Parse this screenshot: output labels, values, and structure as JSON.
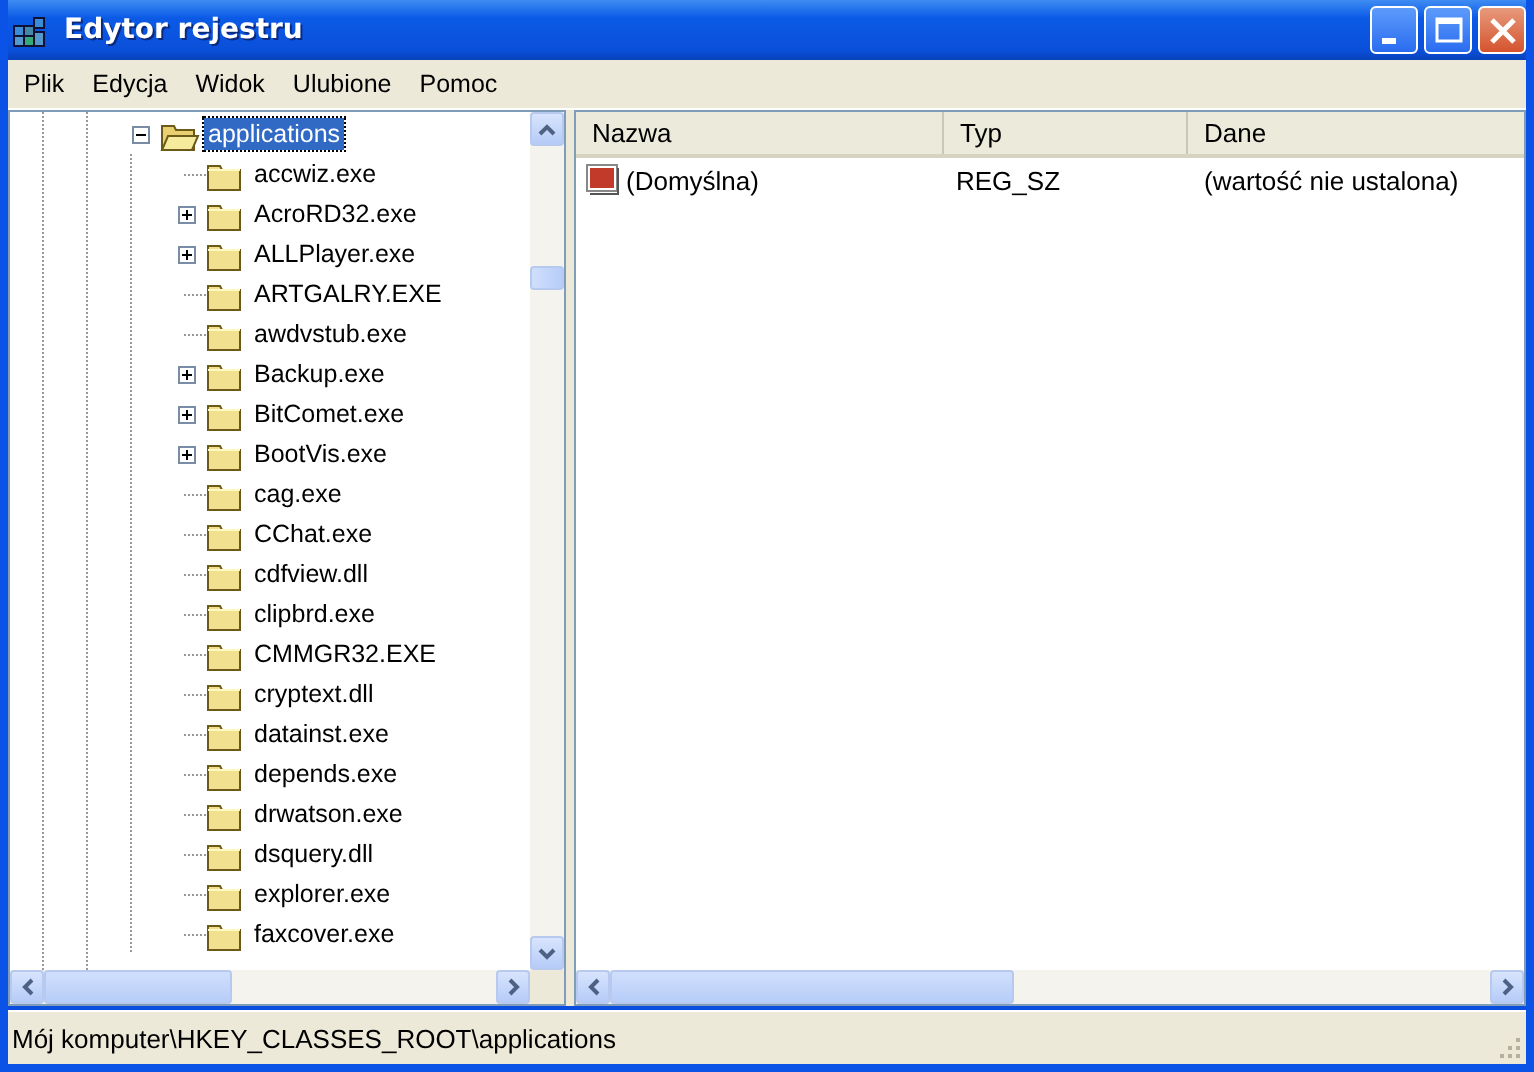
{
  "window": {
    "title": "Edytor rejestru"
  },
  "menu": [
    "Plik",
    "Edycja",
    "Widok",
    "Ulubione",
    "Pomoc"
  ],
  "tree": [
    {
      "label": "applications",
      "expanded": true,
      "selected": true,
      "children": [
        {
          "label": "accwiz.exe",
          "has_children": false,
          "selected": false
        },
        {
          "label": "AcroRD32.exe",
          "has_children": true,
          "selected": false
        },
        {
          "label": "ALLPlayer.exe",
          "has_children": true,
          "selected": false
        },
        {
          "label": "ARTGALRY.EXE",
          "has_children": false,
          "selected": false
        },
        {
          "label": "awdvstub.exe",
          "has_children": false,
          "selected": false
        },
        {
          "label": "Backup.exe",
          "has_children": true,
          "selected": false
        },
        {
          "label": "BitComet.exe",
          "has_children": true,
          "selected": false
        },
        {
          "label": "BootVis.exe",
          "has_children": true,
          "selected": false
        },
        {
          "label": "cag.exe",
          "has_children": false,
          "selected": false
        },
        {
          "label": "CChat.exe",
          "has_children": false,
          "selected": false
        },
        {
          "label": "cdfview.dll",
          "has_children": false,
          "selected": false
        },
        {
          "label": "clipbrd.exe",
          "has_children": false,
          "selected": false
        },
        {
          "label": "CMMGR32.EXE",
          "has_children": false,
          "selected": false
        },
        {
          "label": "cryptext.dll",
          "has_children": false,
          "selected": false
        },
        {
          "label": "datainst.exe",
          "has_children": false,
          "selected": false
        },
        {
          "label": "depends.exe",
          "has_children": false,
          "selected": false
        },
        {
          "label": "drwatson.exe",
          "has_children": false,
          "selected": false
        },
        {
          "label": "dsquery.dll",
          "has_children": false,
          "selected": false
        },
        {
          "label": "explorer.exe",
          "has_children": false,
          "selected": false
        },
        {
          "label": "faxcover.exe",
          "has_children": false,
          "selected": false
        }
      ]
    }
  ],
  "values": {
    "columns": [
      "Nazwa",
      "Typ",
      "Dane"
    ],
    "rows": [
      {
        "name": "(Domyślna)",
        "type": "REG_SZ",
        "data": "(wartość nie ustalona)"
      }
    ]
  },
  "status_bar": "Mój komputer\\HKEY_CLASSES_ROOT\\applications"
}
